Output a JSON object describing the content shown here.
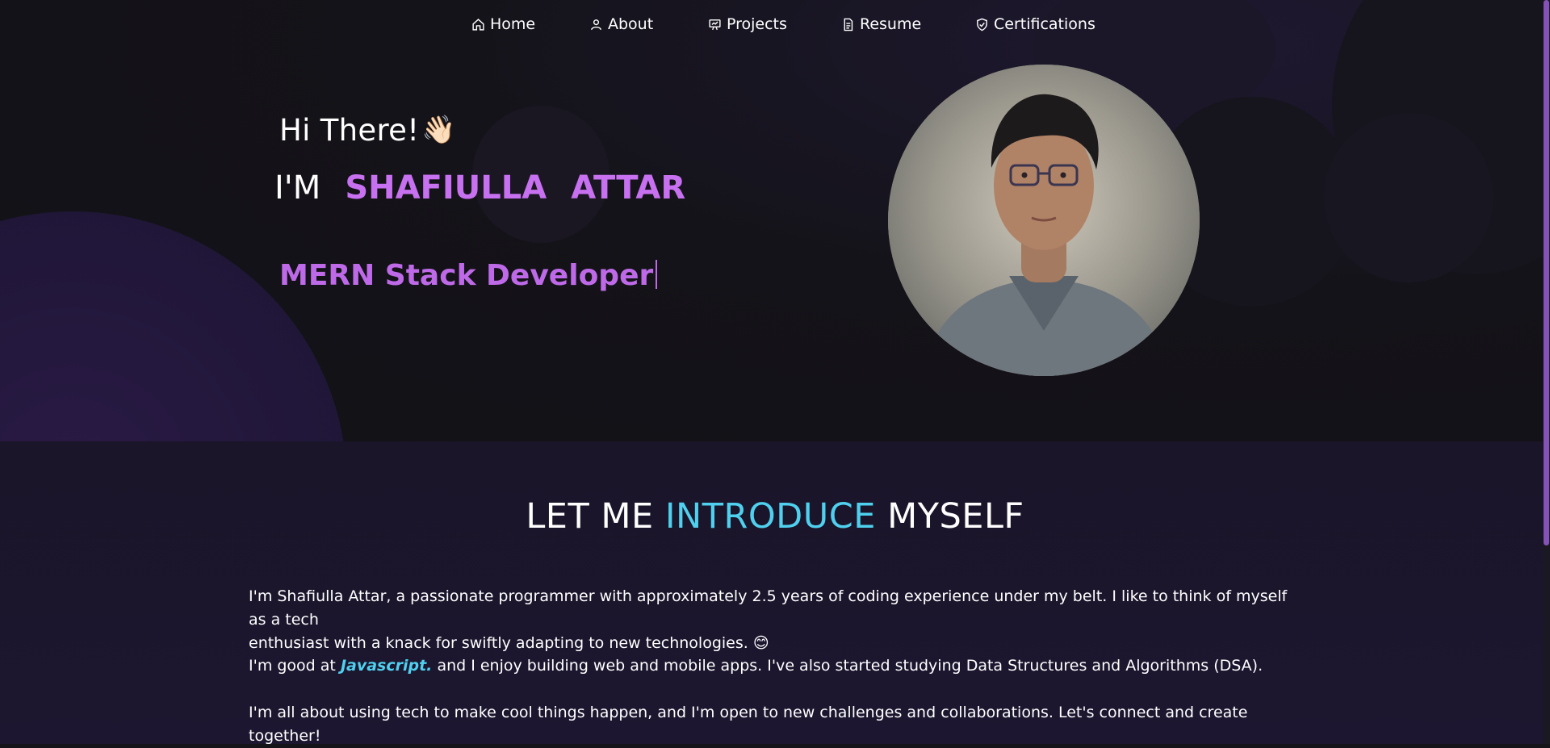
{
  "nav": {
    "items": [
      {
        "label": "Home",
        "icon": "home-icon"
      },
      {
        "label": "About",
        "icon": "user-icon"
      },
      {
        "label": "Projects",
        "icon": "presentation-icon"
      },
      {
        "label": "Resume",
        "icon": "document-icon"
      },
      {
        "label": "Certifications",
        "icon": "shield-check-icon"
      }
    ]
  },
  "hero": {
    "greeting": "Hi There!",
    "wave_emoji": "👋🏻",
    "im": "I'M",
    "first_name": "SHAFIULLA",
    "last_name": "ATTAR",
    "role": "MERN Stack Developer",
    "avatar_icon": "profile-photo"
  },
  "intro": {
    "heading_part1": "LET ME",
    "heading_accent": "INTRODUCE",
    "heading_part2": "MYSELF",
    "p1_line1": "I'm Shafiulla Attar, a passionate programmer with approximately 2.5 years of coding experience under my belt. I like to think of myself as a tech",
    "p1_line2": "enthusiast with a knack for swiftly adapting to new technologies. 😊",
    "p2_prefix": "I'm good at",
    "p2_highlight": "Javascript.",
    "p2_suffix": "and I enjoy building web and mobile apps. I've also started studying Data Structures and Algorithms (DSA).",
    "p3": "I'm all about using tech to make cool things happen, and I'm open to new challenges and collaborations. Let's connect and create together!"
  },
  "colors": {
    "purple_accent": "#c770f0",
    "cyan_accent": "#4fd0ee",
    "background": "#15141b"
  }
}
